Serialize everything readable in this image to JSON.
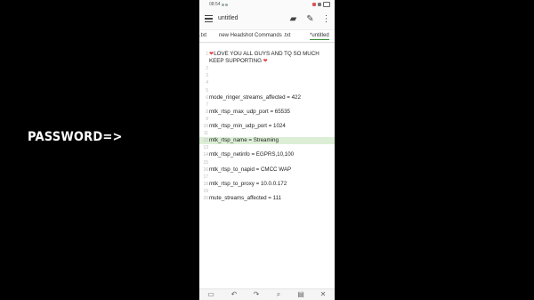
{
  "overlay": {
    "text": "PASSWORD=>"
  },
  "statusbar": {
    "time": "08:54"
  },
  "toolbar": {
    "title": "untitled",
    "icons": [
      "menu-icon",
      "folder-icon",
      "pencil-icon",
      "more-vertical-icon"
    ]
  },
  "tabs": [
    {
      "label": ".txt"
    },
    {
      "label": "new Headshot Commands .txt"
    },
    {
      "label": "*untitled"
    }
  ],
  "editor": {
    "lines": [
      {
        "num": "1",
        "text": "LOVE YOU ALL GUYS AND TQ SO MUCH"
      },
      {
        "num": "",
        "text": "KEEP SUPPORTING"
      },
      {
        "num": "2",
        "text": ""
      },
      {
        "num": "3",
        "text": ""
      },
      {
        "num": "4",
        "text": ""
      },
      {
        "num": "5",
        "text": ""
      },
      {
        "num": "6",
        "text": "mode_ringer_streams_affected = 422"
      },
      {
        "num": "7",
        "text": ""
      },
      {
        "num": "8",
        "text": "mtk_rtsp_max_udp_port = 65535"
      },
      {
        "num": "9",
        "text": ""
      },
      {
        "num": "10",
        "text": "mtk_rtsp_min_udp_port = 1024"
      },
      {
        "num": "11",
        "text": ""
      },
      {
        "num": "12",
        "text": "mtk_rtsp_name = Streaming"
      },
      {
        "num": "13",
        "text": ""
      },
      {
        "num": "14",
        "text": "mtk_rtsp_netinfo = EGPRS,10,100"
      },
      {
        "num": "15",
        "text": ""
      },
      {
        "num": "16",
        "text": "mtk_rtsp_to_napid = CMCC WAP"
      },
      {
        "num": "17",
        "text": ""
      },
      {
        "num": "18",
        "text": "mtk_rtsp_to_proxy = 10.0.0.172"
      },
      {
        "num": "19",
        "text": ""
      },
      {
        "num": "20",
        "text": "mute_streams_affected = 111"
      }
    ],
    "heart": "❤",
    "highlight_color": "#dcefd6"
  },
  "bottombar": {
    "icons": [
      "folder-icon",
      "undo-icon",
      "redo-icon",
      "search-icon",
      "save-icon",
      "close-icon"
    ]
  }
}
